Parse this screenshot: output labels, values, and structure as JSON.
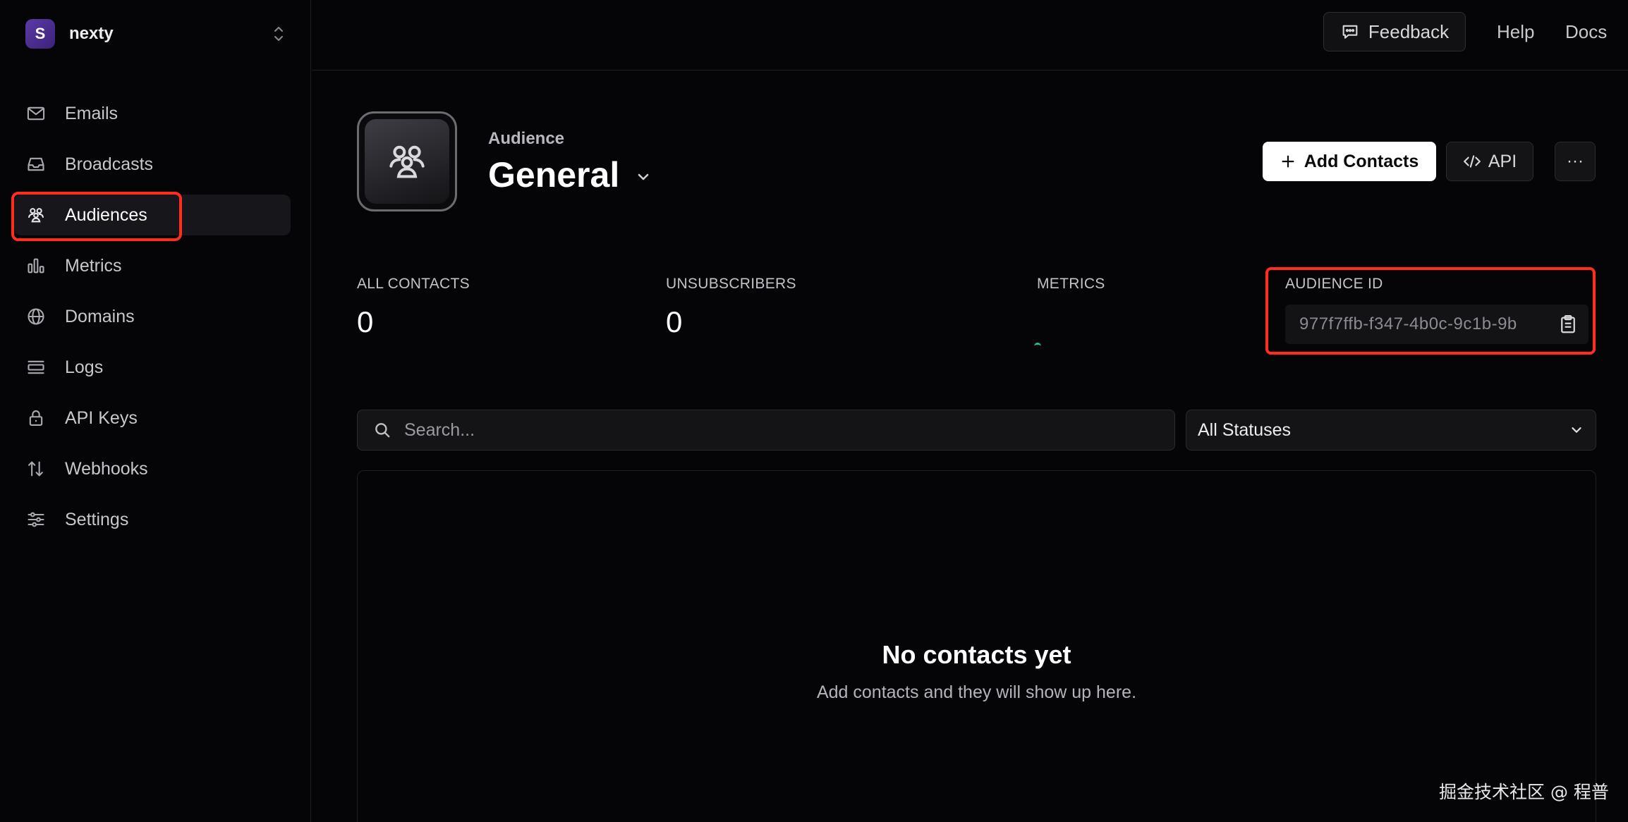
{
  "team": {
    "initial": "S",
    "name": "nexty"
  },
  "sidebar": {
    "items": [
      {
        "label": "Emails",
        "icon": "mail-icon"
      },
      {
        "label": "Broadcasts",
        "icon": "inbox-icon"
      },
      {
        "label": "Audiences",
        "icon": "users-icon"
      },
      {
        "label": "Metrics",
        "icon": "bar-chart-icon"
      },
      {
        "label": "Domains",
        "icon": "globe-icon"
      },
      {
        "label": "Logs",
        "icon": "logs-icon"
      },
      {
        "label": "API Keys",
        "icon": "lock-icon"
      },
      {
        "label": "Webhooks",
        "icon": "arrows-icon"
      },
      {
        "label": "Settings",
        "icon": "sliders-icon"
      }
    ],
    "active": "Audiences"
  },
  "topbar": {
    "feedback": "Feedback",
    "help": "Help",
    "docs": "Docs"
  },
  "header": {
    "label": "Audience",
    "title": "General",
    "add_contacts": "Add Contacts",
    "api": "API",
    "more": "···"
  },
  "stats": {
    "all_contacts_label": "ALL CONTACTS",
    "all_contacts_value": "0",
    "unsubscribers_label": "UNSUBSCRIBERS",
    "unsubscribers_value": "0",
    "metrics_label": "METRICS",
    "audience_id_label": "AUDIENCE ID",
    "audience_id_value": "977f7ffb-f347-4b0c-9c1b-9b"
  },
  "filters": {
    "search_placeholder": "Search...",
    "status_selected": "All Statuses"
  },
  "empty": {
    "title": "No contacts yet",
    "subtitle": "Add contacts and they will show up here."
  },
  "watermark": "掘金技术社区 @ 程普",
  "colors": {
    "accent_highlight": "#ff2d20",
    "background": "#050507",
    "metrics_dot": "#1fbf8f"
  }
}
